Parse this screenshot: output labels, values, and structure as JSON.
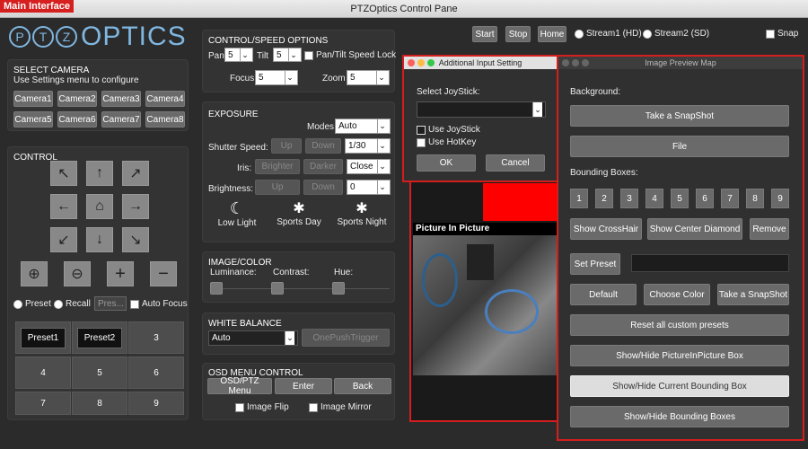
{
  "window": {
    "title": "PTZOptics Control Pane",
    "badge": "Main Interface"
  },
  "logo": {
    "ptz": [
      "P",
      "T",
      "Z"
    ],
    "optics": "OPTICS"
  },
  "top": {
    "start": "Start",
    "stop": "Stop",
    "home": "Home",
    "stream1": "Stream1 (HD)",
    "stream2": "Stream2 (SD)",
    "snap": "Snap"
  },
  "select_camera": {
    "title": "SELECT CAMERA",
    "subtitle": "Use Settings menu to configure",
    "cameras": [
      "Camera1",
      "Camera2",
      "Camera3",
      "Camera4",
      "Camera5",
      "Camera6",
      "Camera7",
      "Camera8"
    ]
  },
  "control": {
    "title": "CONTROL",
    "preset": "Preset",
    "recall": "Recall",
    "preset_placeholder": "Pres...",
    "auto_focus": "Auto Focus",
    "presets": [
      "Preset1",
      "Preset2",
      "3",
      "4",
      "5",
      "6",
      "7",
      "8",
      "9"
    ]
  },
  "speed": {
    "title": "CONTROL/SPEED OPTIONS",
    "pan": "Pan",
    "pan_val": "5",
    "tilt": "Tilt",
    "tilt_val": "5",
    "lock": "Pan/Tilt Speed Lock",
    "focus": "Focus",
    "focus_val": "5",
    "zoom": "Zoom",
    "zoom_val": "5"
  },
  "exposure": {
    "title": "EXPOSURE",
    "modes": "Modes",
    "modes_val": "Auto",
    "shutter": "Shutter Speed:",
    "shutter_val": "1/30",
    "iris": "Iris:",
    "iris_val": "Close",
    "brightness": "Brightness:",
    "brightness_val": "0",
    "up": "Up",
    "down": "Down",
    "brighter": "Brighter",
    "darker": "Darker",
    "low_light": "Low Light",
    "sports_day": "Sports Day",
    "sports_night": "Sports Night"
  },
  "image_color": {
    "title": "IMAGE/COLOR",
    "luminance": "Luminance:",
    "contrast": "Contrast:",
    "hue": "Hue:"
  },
  "white_balance": {
    "title": "WHITE BALANCE",
    "value": "Auto",
    "one_push": "OnePushTrigger"
  },
  "osd": {
    "title": "OSD MENU CONTROL",
    "osd_ptz": "OSD/PTZ Menu",
    "enter": "Enter",
    "back": "Back",
    "flip": "Image Flip",
    "mirror": "Image Mirror"
  },
  "pip": {
    "title": "Picture In Picture"
  },
  "additional": {
    "title": "Additional Input Setting",
    "select_joystick": "Select JoyStick:",
    "use_joystick": "Use JoyStick",
    "use_hotkey": "Use HotKey",
    "ok": "OK",
    "cancel": "Cancel"
  },
  "preview": {
    "title": "Image Preview Map",
    "background": "Background:",
    "take_snapshot": "Take a SnapShot",
    "file": "File",
    "bounding_boxes": "Bounding Boxes:",
    "numbers": [
      "1",
      "2",
      "3",
      "4",
      "5",
      "6",
      "7",
      "8",
      "9"
    ],
    "crosshair": "Show CrossHair",
    "center_diamond": "Show Center Diamond",
    "remove": "Remove",
    "set_preset": "Set Preset",
    "default": "Default",
    "choose_color": "Choose Color",
    "snapshot2": "Take a SnapShot",
    "reset": "Reset all custom presets",
    "pip_box": "Show/Hide PictureInPicture Box",
    "current_box": "Show/Hide Current Bounding Box",
    "boxes": "Show/Hide Bounding Boxes"
  }
}
